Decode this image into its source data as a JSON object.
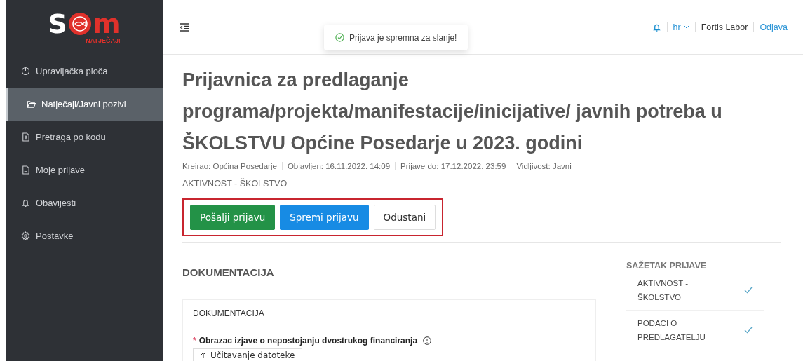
{
  "logo": {
    "letters": [
      "S",
      "m"
    ],
    "subtitle": "NATJEČAJI"
  },
  "sidebar": {
    "items": [
      {
        "label": "Upravljačka ploča",
        "selected": false
      },
      {
        "label": "Natječaji/Javni pozivi",
        "selected": true
      },
      {
        "label": "Pretraga po kodu",
        "selected": false
      },
      {
        "label": "Moje prijave",
        "selected": false
      },
      {
        "label": "Obavijesti",
        "selected": false
      },
      {
        "label": "Postavke",
        "selected": false
      }
    ]
  },
  "topbar": {
    "language": "hr",
    "user": "Fortis Labor",
    "logout": "Odjava"
  },
  "toast": {
    "message": "Prijava je spremna za slanje!"
  },
  "page": {
    "title": "Prijavnica za predlaganje programa/projekta/manifestacije/inicijative/ javnih potreba u ŠKOLSTVU Općine Posedarje u 2023. godini",
    "meta": [
      "Kreirao: Općina Posedarje",
      "Objavljen: 16.11.2022. 14:09",
      "Prijave do: 17.12.2022. 23:59",
      "Vidljivost: Javni"
    ],
    "category": "AKTIVNOST - ŠKOLSTVO",
    "buttons": [
      {
        "label": "Pošalji prijavu",
        "kind": "success"
      },
      {
        "label": "Spremi prijavu",
        "kind": "primary"
      },
      {
        "label": "Odustani",
        "kind": "default"
      }
    ]
  },
  "section": {
    "heading": "DOKUMENTACIJA",
    "card_title": "DOKUMENTACIJA",
    "field_label": "Obrazac izjave o nepostojanju dvostrukog financiranja",
    "required_mark": "*",
    "upload_button": "Učitavanje datoteke"
  },
  "summary": {
    "heading": "SAŽETAK PRIJAVE",
    "items": [
      {
        "label": "AKTIVNOST - ŠKOLSTVO",
        "done": true
      },
      {
        "label": "PODACI O PREDLAGATELJU",
        "done": true
      }
    ]
  }
}
